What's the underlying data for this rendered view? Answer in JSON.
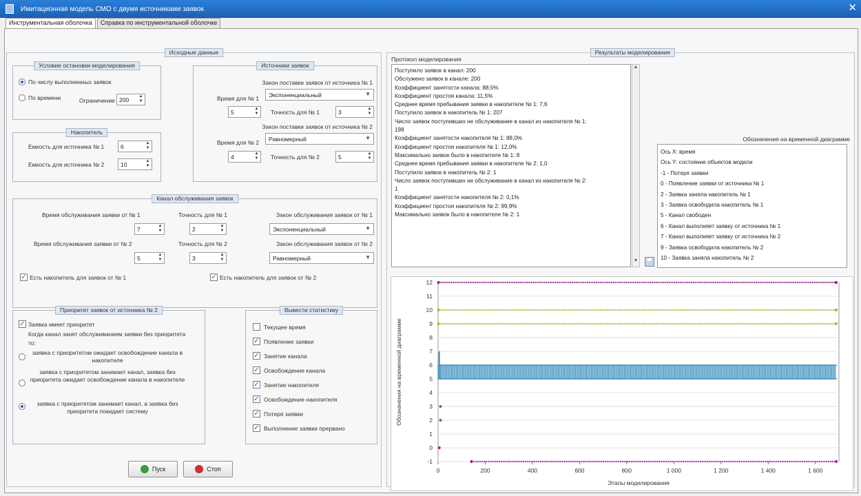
{
  "window": {
    "title": "Имитационная модель СМО с двумя источниками заявок"
  },
  "tabs": [
    "Инструментальная оболочка",
    "Справка по инструментальной оболочке"
  ],
  "input": {
    "title": "Исходные данные",
    "stop": {
      "title": "Условие остановки моделирования",
      "by_count": "По числу выполненных заявок",
      "by_time": "По времени",
      "limit_label": "Ограничение",
      "limit_value": "200"
    },
    "buffer": {
      "title": "Накопитель",
      "cap1_label": "Емкость для источника № 1",
      "cap1_value": "6",
      "cap2_label": "Емкость для источника № 2",
      "cap2_value": "10"
    },
    "sources": {
      "title": "Источники заявок",
      "law1_label": "Закон поставки заявок от источника № 1",
      "time1_label": "Время для № 1",
      "law1_value": "Экспоненциальный",
      "time1_value": "5",
      "acc1_label": "Точность для № 1",
      "acc1_value": "3",
      "law2_label": "Закон поставки заявок от источника № 2",
      "time2_label": "Время для № 2",
      "law2_value": "Равномерный",
      "time2_value": "4",
      "acc2_label": "Точность для № 2",
      "acc2_value": "5"
    },
    "channel": {
      "title": "Канал обслуживания заявок",
      "svc1_label": "Время обслуживания заявки от № 1",
      "svc1_value": "7",
      "acc1_label": "Точность для № 1",
      "acc1_value": "2",
      "law1_label": "Закон обслуживания заявок от № 1",
      "law1_value": "Экспоненциальный",
      "svc2_label": "Время обслуживания заявки от № 2",
      "svc2_value": "5",
      "acc2_label": "Точность для № 2",
      "acc2_value": "3",
      "law2_label": "Закон обслуживания заявок от № 2",
      "law2_value": "Равномерный",
      "buf1_label": "Есть накопитель для заявок от № 1",
      "buf2_label": "Есть накопитель для заявок от № 2"
    },
    "priority": {
      "title": "Приоритет заявок от источника № 2",
      "has_priority": "Заявка имеет приоритет",
      "when_busy": "Когда канал занят обслуживанием заявки без приоритета",
      "to": "то:",
      "opt1": "заявка с приоритетом ожидает освобождение канала в накопителе",
      "opt2": "заявка с приоритетом занимает канал, заявка без приоритета ожидает освобождение канала в накопителе",
      "opt3": "заявка с приоритетом занимает канал, а заявка без приоритета покидает систему"
    },
    "stats": {
      "title": "Вывести статистику",
      "items": [
        "Текущее время",
        "Появление заявки",
        "Занятие канала",
        "Освобождение канала",
        "Занятие накопителя",
        "Освобождение накопителя",
        "Потеря заявки",
        "Выполнение заявки прервано"
      ],
      "checked": [
        false,
        true,
        true,
        true,
        true,
        true,
        true,
        true
      ]
    },
    "buttons": {
      "start": "Пуск",
      "stop": "Стоп"
    }
  },
  "results": {
    "title": "Результаты моделирования",
    "protocol_label": "Протокол моделирования",
    "protocol": [
      "Поступило заявок в канал: 200",
      "Обслужено заявок в канале: 200",
      "Коэффициент занятости канала: 88,5%",
      "Коэффициент простоя канала: 11,5%",
      "Среднее время пребывания заявки в накопителе № 1:   7,6",
      "Поступило заявок в накопитель № 1: 207",
      "Число заявок поступивших не обслуживание в канал из накопителя № 1:",
      "198",
      "Коэффициент занятости накопителя № 1: 88,0%",
      "Коэффициент простоя накопителя № 1: 12,0%",
      "Максимально заявок было в накопителе № 1: 8",
      "Среднее время пребывания заявки в накопителе № 2:   1,0",
      "Поступило заявок в накопитель № 2: 1",
      "Число заявок поступивших не обслуживание в канал из накопителя № 2:",
      "1",
      "Коэффициент занятости накопителя № 2:  0,1%",
      "Коэффициент простоя накопителя № 2: 99,9%",
      "Максимально заявок было в накопителе № 2: 1"
    ],
    "legend_label": "Обозначения на временной диаграмме",
    "legend": [
      "Ось X: время",
      "Ось Y: состояние объектов модели",
      "-1 - Потеря заявки",
      "0 - Появление заявки от источника № 1",
      "2 - Заявка заняла накопитель № 1",
      "3 - Заявка освободила накопитель № 1",
      "5 - Канал свободен",
      "6 - Канал выполняет заявку от источника № 1",
      "7 - Канал выполняет заявку от источника № 2",
      "9 - Заявка освободила накопитель № 2",
      "10 - Заявка заняла накопитель № 2"
    ]
  },
  "chart_data": {
    "type": "scatter",
    "title": "",
    "xlabel": "Этапы моделирования",
    "ylabel": "Обозначения на временной диаграмме",
    "xlim": [
      0,
      1700
    ],
    "ylim": [
      -1,
      12
    ],
    "xticks": [
      "0",
      "200",
      "400",
      "600",
      "800",
      "1 000",
      "1 200",
      "1 400",
      "1 600"
    ],
    "yticks": [
      "-1",
      "0",
      "1",
      "2",
      "3",
      "4",
      "5",
      "6",
      "7",
      "8",
      "9",
      "10",
      "11",
      "12"
    ],
    "series": [
      {
        "y": 12,
        "x_range": [
          0,
          1690
        ],
        "color": "#8b1a8b",
        "style": "dotted-line"
      },
      {
        "y": 10,
        "x_range": [
          0,
          1690
        ],
        "color": "#b5b52e",
        "style": "dotted-line"
      },
      {
        "y": 9,
        "x_range": [
          0,
          1690
        ],
        "color": "#b5b52e",
        "style": "dotted-line"
      },
      {
        "y": 6,
        "x_range": [
          0,
          1690
        ],
        "color": "#3a8fbf",
        "style": "impulses-from-5"
      },
      {
        "y": 7,
        "x": [
          5
        ],
        "color": "#3a8fbf",
        "style": "impulse"
      },
      {
        "y": 3,
        "x": [
          10
        ],
        "color": "#2e8b57",
        "style": "point"
      },
      {
        "y": 2,
        "x": [
          10
        ],
        "color": "#2e8b57",
        "style": "point"
      },
      {
        "y": 0,
        "x": [
          5
        ],
        "color": "#b0186e",
        "style": "point"
      },
      {
        "y": -1,
        "x_range": [
          140,
          1690
        ],
        "color": "#8b1a8b",
        "style": "dotted-line"
      }
    ]
  }
}
